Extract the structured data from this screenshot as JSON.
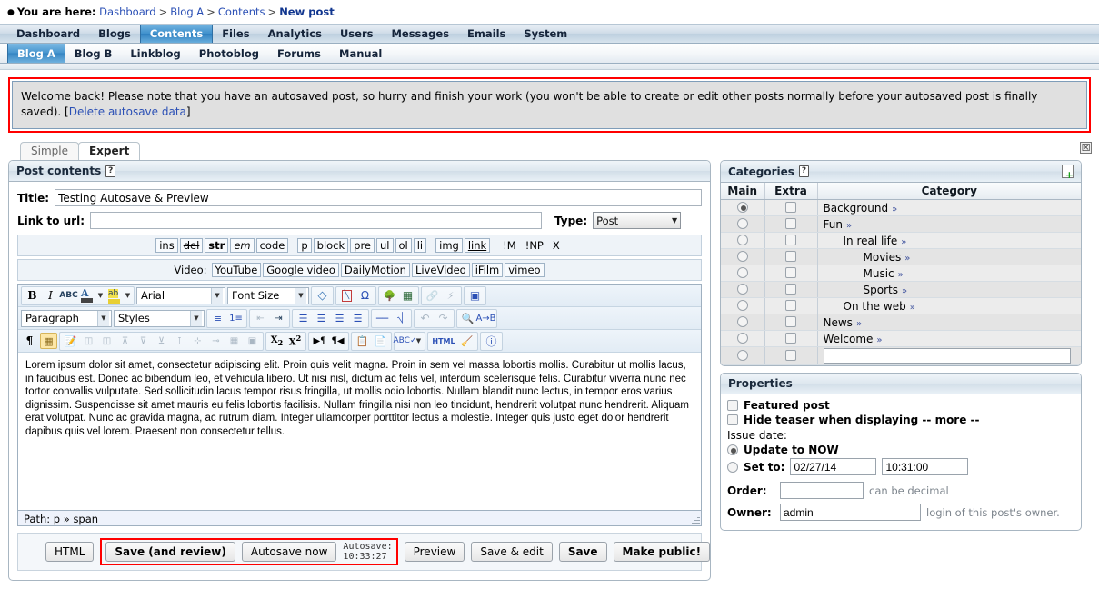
{
  "breadcrumb": {
    "prefix": "You are here:",
    "items": [
      "Dashboard",
      "Blog A",
      "Contents"
    ],
    "current": "New post",
    "separator": ">"
  },
  "mainnav": {
    "items": [
      "Dashboard",
      "Blogs",
      "Contents",
      "Files",
      "Analytics",
      "Users",
      "Messages",
      "Emails",
      "System"
    ],
    "active": "Contents"
  },
  "subnav": {
    "items": [
      "Blog A",
      "Blog B",
      "Linkblog",
      "Photoblog",
      "Forums",
      "Manual"
    ],
    "active": "Blog A"
  },
  "alert": {
    "text": "Welcome back! Please note that you have an autosaved post, so hurry and finish your work (you won't be able to create or edit other posts normally before your autosaved post is finally saved). [",
    "link": "Delete autosave data",
    "text_end": "]"
  },
  "tabs": {
    "items": [
      "Simple",
      "Expert"
    ],
    "active": "Expert",
    "close_icon": "close-icon",
    "close_glyph": "☒"
  },
  "post_contents": {
    "title": "Post contents",
    "help_icon": "?",
    "title_label": "Title:",
    "title_value": "Testing Autosave & Preview",
    "url_label": "Link to url:",
    "url_value": "",
    "type_label": "Type:",
    "type_value": "Post"
  },
  "quicktags": {
    "tags": [
      "ins",
      "del",
      "str",
      "em",
      "code",
      "p",
      "block",
      "pre",
      "ul",
      "ol",
      "li",
      "img",
      "link",
      "!M",
      "!NP",
      "X"
    ],
    "video_label": "Video:",
    "video_tags": [
      "YouTube",
      "Google video",
      "DailyMotion",
      "LiveVideo",
      "iFilm",
      "vimeo"
    ]
  },
  "editor": {
    "font_family": "Arial",
    "font_size": "Font Size",
    "paragraph": "Paragraph",
    "styles": "Styles",
    "content": "Lorem ipsum dolor sit amet, consectetur adipiscing elit. Proin quis velit magna. Proin in sem vel massa lobortis mollis. Curabitur ut mollis lacus, in faucibus est. Donec ac bibendum leo, et vehicula libero. Ut nisi nisl, dictum ac felis vel, interdum scelerisque felis. Curabitur viverra nunc nec tortor convallis vulputate. Sed sollicitudin lacus tempor risus fringilla, ut mollis odio lobortis. Nullam blandit nunc lectus, in tempor eros varius dignissim. Suspendisse sit amet mauris eu felis lobortis facilisis. Nullam fringilla nisi non leo tincidunt, hendrerit volutpat nunc hendrerit. Aliquam erat volutpat. Nunc ac gravida magna, ac rutrum diam. Integer ullamcorper porttitor lectus a molestie. Integer quis justo eget dolor hendrerit dapibus quis vel lorem. Praesent non consectetur tellus.",
    "path_label": "Path: p » span"
  },
  "actions": {
    "html": "HTML",
    "save_and_review": "Save (and review)",
    "autosave_now": "Autosave now",
    "autosave_status": "Autosave: 10:33:27",
    "preview": "Preview",
    "save_and_edit": "Save & edit",
    "save": "Save",
    "make_public": "Make public!"
  },
  "categories": {
    "title": "Categories",
    "help_icon": "?",
    "add_icon": "new-document-icon",
    "columns": [
      "Main",
      "Extra",
      "Category"
    ],
    "rows": [
      {
        "name": "Background",
        "indent": 0,
        "main": true,
        "extra": false,
        "chev": "»"
      },
      {
        "name": "Fun",
        "indent": 0,
        "main": false,
        "extra": false,
        "chev": "»"
      },
      {
        "name": "In real life",
        "indent": 1,
        "main": false,
        "extra": false,
        "chev": "»"
      },
      {
        "name": "Movies",
        "indent": 2,
        "main": false,
        "extra": false,
        "chev": "»"
      },
      {
        "name": "Music",
        "indent": 2,
        "main": false,
        "extra": false,
        "chev": "»"
      },
      {
        "name": "Sports",
        "indent": 2,
        "main": false,
        "extra": false,
        "chev": "»"
      },
      {
        "name": "On the web",
        "indent": 1,
        "main": false,
        "extra": false,
        "chev": "»"
      },
      {
        "name": "News",
        "indent": 0,
        "main": false,
        "extra": false,
        "chev": "»"
      },
      {
        "name": "Welcome",
        "indent": 0,
        "main": false,
        "extra": false,
        "chev": "»"
      }
    ],
    "new_category_value": ""
  },
  "properties": {
    "title": "Properties",
    "featured_post": "Featured post",
    "hide_teaser": "Hide teaser when displaying -- more --",
    "issue_date_label": "Issue date:",
    "update_now": "Update to NOW",
    "set_to": "Set to:",
    "date_value": "02/27/14",
    "time_value": "10:31:00",
    "order_label": "Order:",
    "order_value": "",
    "order_hint": "can be decimal",
    "owner_label": "Owner:",
    "owner_value": "admin",
    "owner_hint": "login of this post's owner."
  },
  "colors": {
    "accent": "#3484c2",
    "alert_border": "#ff0000",
    "link": "#2a4fb5"
  }
}
